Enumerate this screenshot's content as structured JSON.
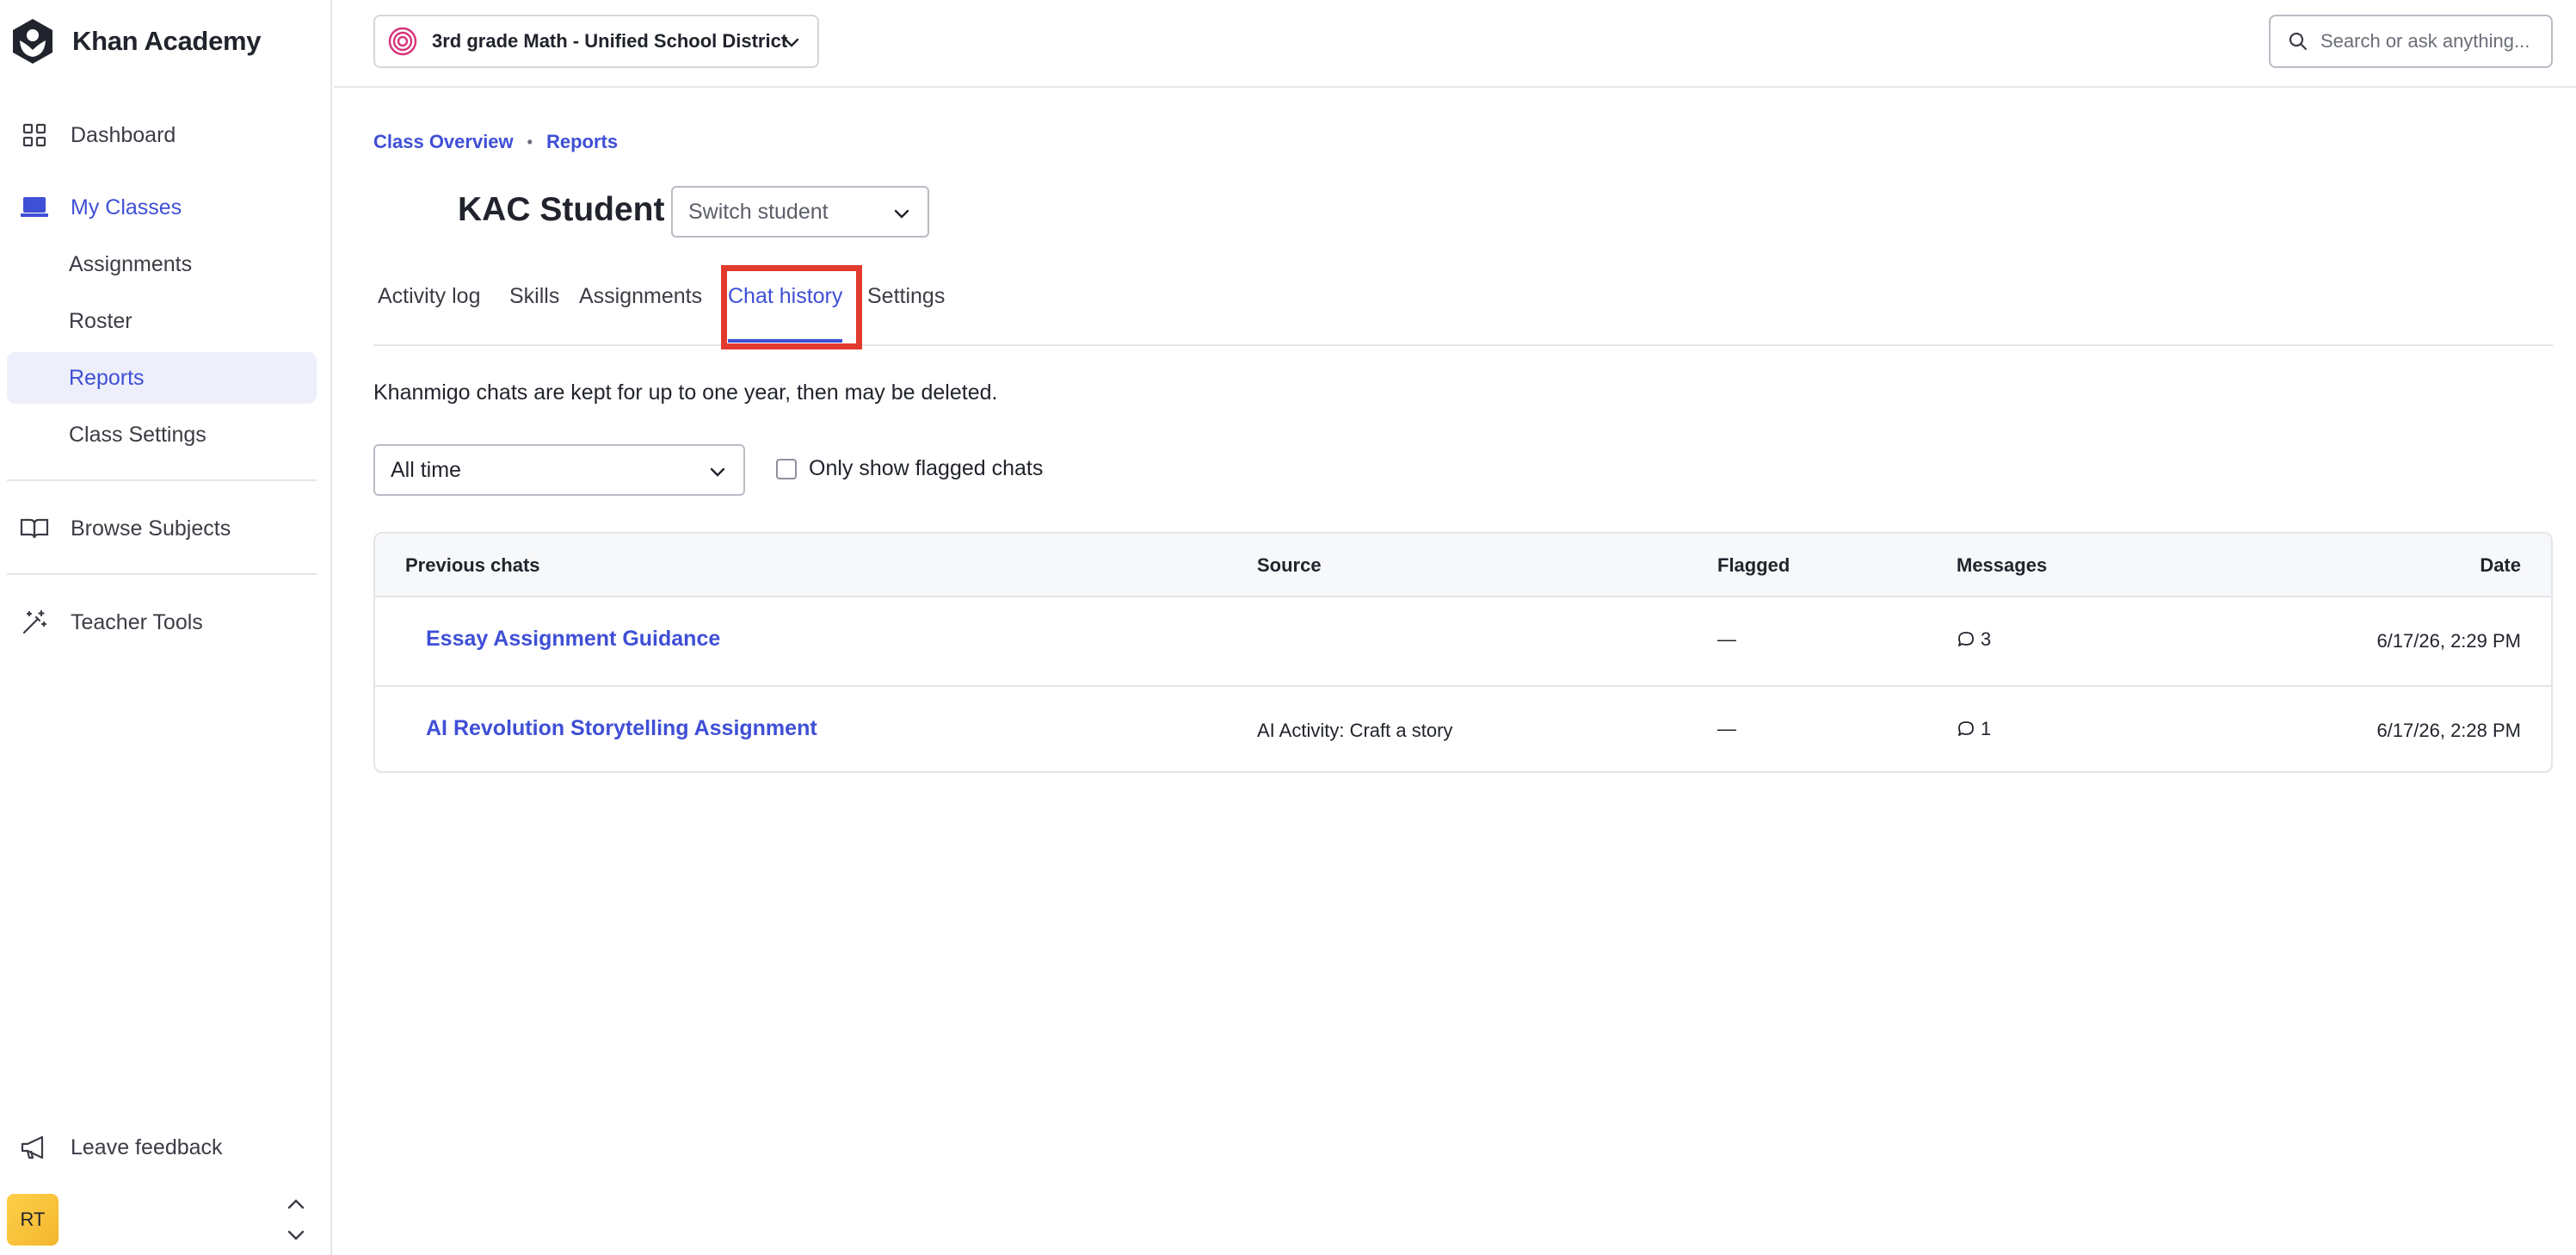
{
  "app": {
    "name": "Khan Academy"
  },
  "sidebar": {
    "dashboard": "Dashboard",
    "my_classes": "My Classes",
    "sub_items": [
      "Assignments",
      "Roster",
      "Reports",
      "Class Settings"
    ],
    "browse_subjects": "Browse Subjects",
    "teacher_tools": "Teacher Tools",
    "leave_feedback": "Leave feedback",
    "user_initials": "RT"
  },
  "topbar": {
    "class_name": "3rd grade Math - Unified School District",
    "search_placeholder": "Search or ask anything..."
  },
  "breadcrumb": {
    "items": [
      "Class Overview",
      "Reports"
    ]
  },
  "student": {
    "name": "KAC Student",
    "switch_label": "Switch student"
  },
  "tabs": [
    "Activity log",
    "Skills",
    "Assignments",
    "Chat history",
    "Settings"
  ],
  "active_tab": "Chat history",
  "notice": "Khanmigo chats are kept for up to one year, then may be deleted.",
  "filters": {
    "time_range": "All time",
    "flagged_only_label": "Only show flagged chats",
    "flagged_only_checked": false
  },
  "table": {
    "headers": [
      "Previous chats",
      "Source",
      "Flagged",
      "Messages",
      "Date"
    ],
    "rows": [
      {
        "title": "Essay Assignment Guidance",
        "source": "",
        "flagged": "—",
        "messages": "3",
        "date": "6/17/26, 2:29 PM"
      },
      {
        "title": "AI Revolution Storytelling Assignment",
        "source": "AI Activity: Craft a story",
        "flagged": "—",
        "messages": "1",
        "date": "6/17/26, 2:28 PM"
      }
    ]
  },
  "colors": {
    "accent": "#3f4fd6",
    "highlight_box": "#e23a2e",
    "active_bg": "#edeffa"
  }
}
